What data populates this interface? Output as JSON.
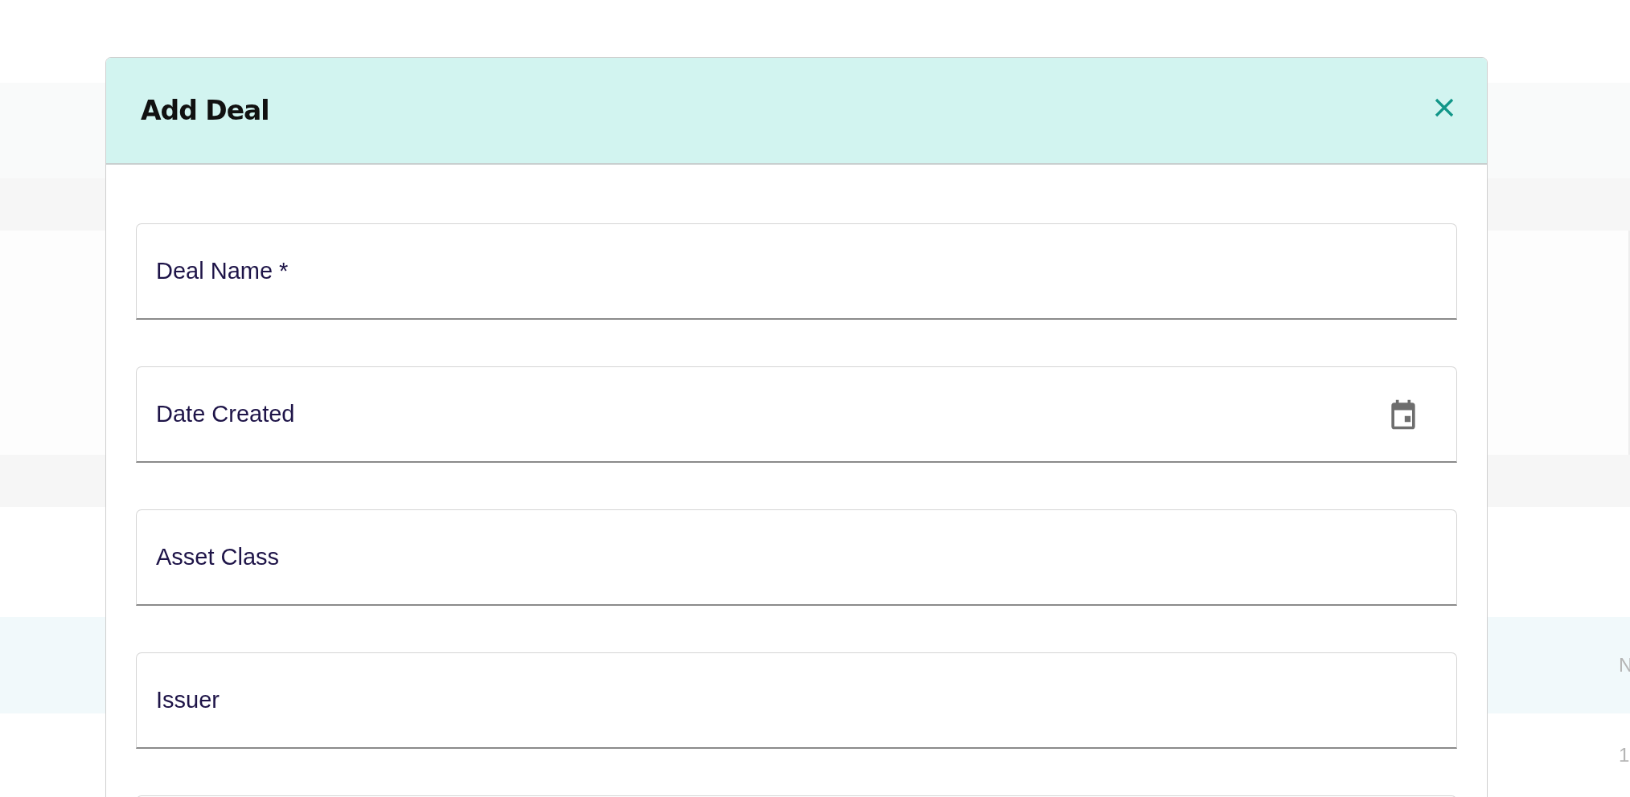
{
  "background_table": {
    "columns": [
      "N"
    ],
    "rows": [
      [
        "1"
      ]
    ]
  },
  "dialog": {
    "title": "Add Deal",
    "fields": [
      {
        "kind": "text",
        "label": "Deal Name *"
      },
      {
        "kind": "date",
        "label": "Date Created"
      },
      {
        "kind": "text",
        "label": "Asset Class"
      },
      {
        "kind": "text",
        "label": "Issuer"
      },
      {
        "kind": "text"
      }
    ]
  }
}
